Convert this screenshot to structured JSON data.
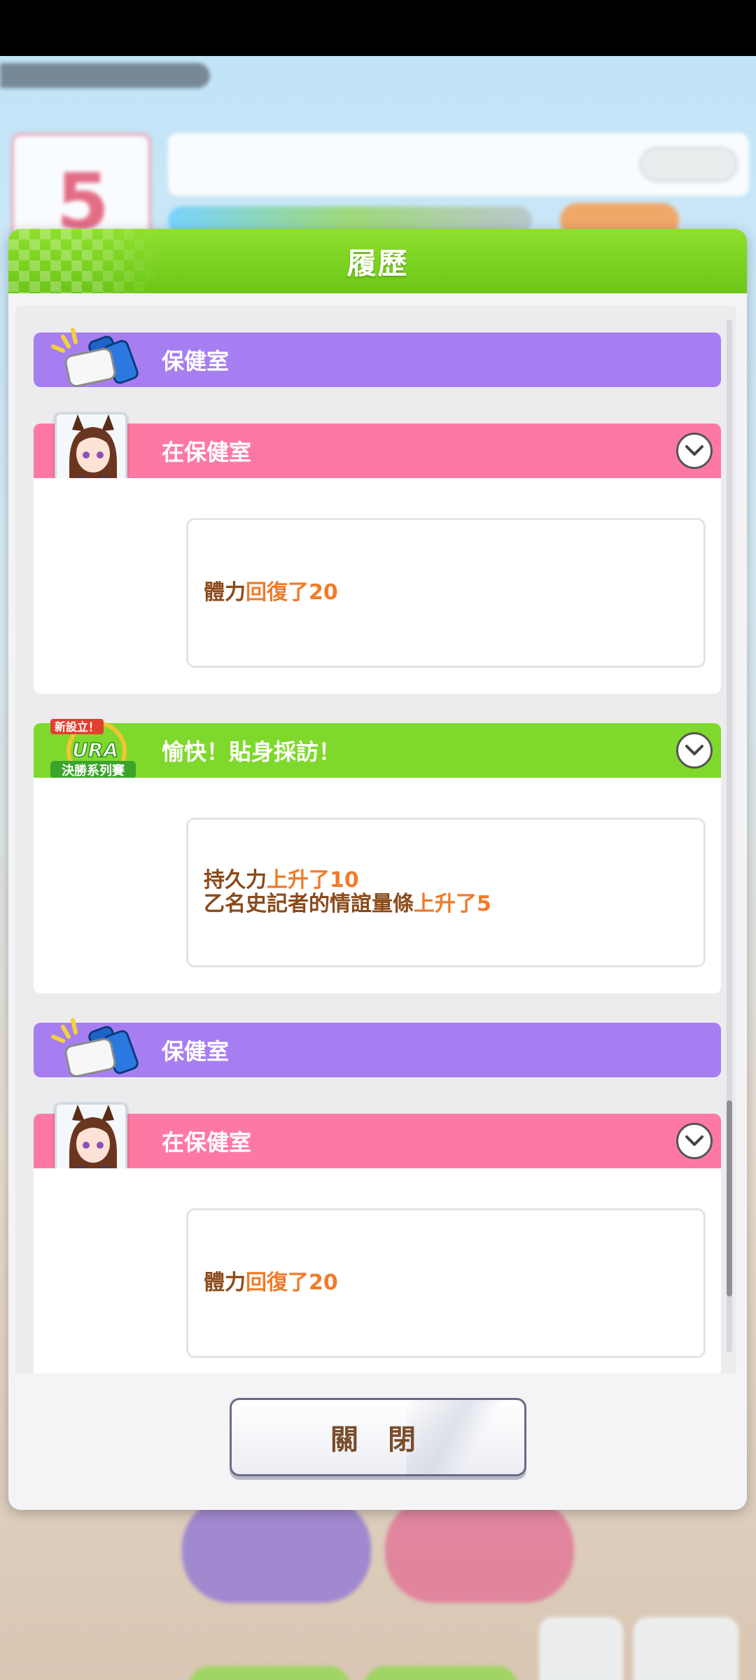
{
  "dialog": {
    "title": "履歷",
    "close_label": "關 閉"
  },
  "background_hud": {
    "calendar_day": "5"
  },
  "entries": [
    {
      "type": "category",
      "color": "#a77ef2",
      "icon": "pillow-and-drinks-icon",
      "label": "保健室"
    },
    {
      "type": "event",
      "color": "#fd79a3",
      "icon": "horse-girl-portrait",
      "label": "在保健室",
      "effects": [
        {
          "parts": [
            "體力",
            "回復了20"
          ]
        }
      ]
    },
    {
      "type": "event",
      "color": "#7fd92c",
      "icon": "ura-finals-badge",
      "label": "愉快！貼身採訪！",
      "effects": [
        {
          "parts": [
            "持久力",
            "上升了10"
          ]
        },
        {
          "parts": [
            "乙名史記者的情誼量條",
            "上升了5"
          ]
        }
      ]
    },
    {
      "type": "category",
      "color": "#a77ef2",
      "icon": "pillow-and-drinks-icon",
      "label": "保健室"
    },
    {
      "type": "event",
      "color": "#fd79a3",
      "icon": "horse-girl-portrait",
      "label": "在保健室",
      "effects": [
        {
          "parts": [
            "體力",
            "回復了20"
          ]
        }
      ]
    }
  ],
  "badge": {
    "top_text": "新設立！",
    "main_text": "URA",
    "bottom_text": "決勝系列賽"
  }
}
